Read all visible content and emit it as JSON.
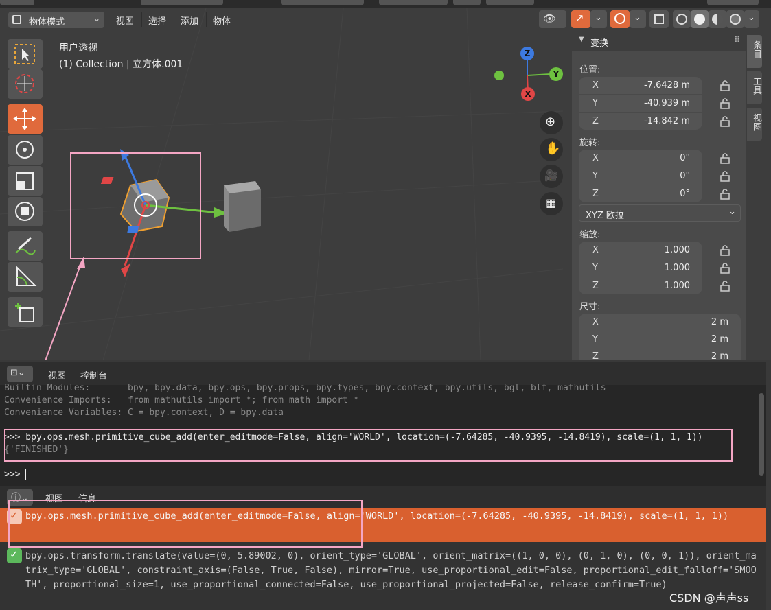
{
  "header": {
    "mode": "物体模式",
    "menus": [
      "视图",
      "选择",
      "添加",
      "物体"
    ]
  },
  "viewport": {
    "view_name": "用户透视",
    "collection_line": "(1) Collection | 立方体.001",
    "gizmo_axes": {
      "x": "X",
      "y": "Y",
      "z": "Z"
    }
  },
  "npanel": {
    "title": "变换",
    "tabs": [
      "条目",
      "工具",
      "视图"
    ],
    "location_label": "位置:",
    "location": [
      {
        "axis": "X",
        "value": "-7.6428 m"
      },
      {
        "axis": "Y",
        "value": "-40.939 m"
      },
      {
        "axis": "Z",
        "value": "-14.842 m"
      }
    ],
    "rotation_label": "旋转:",
    "rotation": [
      {
        "axis": "X",
        "value": "0°"
      },
      {
        "axis": "Y",
        "value": "0°"
      },
      {
        "axis": "Z",
        "value": "0°"
      }
    ],
    "rotation_mode": "XYZ 欧拉",
    "scale_label": "缩放:",
    "scale": [
      {
        "axis": "X",
        "value": "1.000"
      },
      {
        "axis": "Y",
        "value": "1.000"
      },
      {
        "axis": "Z",
        "value": "1.000"
      }
    ],
    "dimensions_label": "尺寸:",
    "dimensions": [
      {
        "axis": "X",
        "value": "2 m"
      },
      {
        "axis": "Y",
        "value": "2 m"
      },
      {
        "axis": "Z",
        "value": "2 m"
      }
    ]
  },
  "console": {
    "menus": [
      "视图",
      "控制台"
    ],
    "lines": [
      "Builtin Modules:       bpy, bpy.data, bpy.ops, bpy.props, bpy.types, bpy.context, bpy.utils, bgl, blf, mathutils",
      "Convenience Imports:   from mathutils import *; from math import *",
      "Convenience Variables: C = bpy.context, D = bpy.data"
    ],
    "command": ">>> bpy.ops.mesh.primitive_cube_add(enter_editmode=False, align='WORLD', location=(-7.64285, -40.9395, -14.8419), scale=(1, 1, 1))",
    "result": "{'FINISHED'}",
    "prompt": ">>> "
  },
  "info": {
    "menus": [
      "视图",
      "信息"
    ],
    "reports": [
      "bpy.ops.mesh.primitive_cube_add(enter_editmode=False, align='WORLD', location=(-7.64285, -40.9395, -14.8419), scale=(1, 1, 1))",
      "bpy.ops.transform.translate(value=(0, 5.89002, 0), orient_type='GLOBAL', orient_matrix=((1, 0, 0), (0, 1, 0), (0, 0, 1)), orient_matrix_type='GLOBAL', constraint_axis=(False, True, False), mirror=True, use_proportional_edit=False, proportional_edit_falloff='SMOOTH', proportional_size=1, use_proportional_connected=False, use_proportional_projected=False, release_confirm=True)"
    ]
  },
  "watermark": "CSDN @声声ss",
  "colors": {
    "accent": "#e06a3c",
    "annotation": "#f4a6c4",
    "x_axis": "#e04646",
    "y_axis": "#6ec140",
    "z_axis": "#3d7ae0"
  }
}
